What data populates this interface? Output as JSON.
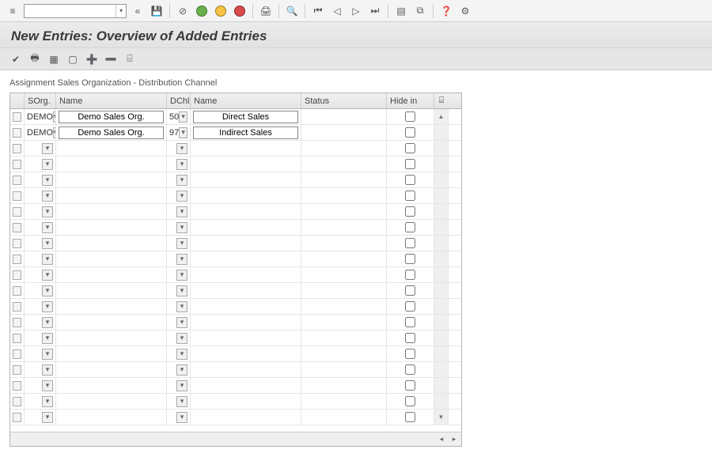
{
  "title": "New Entries: Overview of Added Entries",
  "section_label": "Assignment Sales Organization - Distribution Channel",
  "columns": {
    "sorg": "SOrg.",
    "name1": "Name",
    "dchl": "DChl",
    "name2": "Name",
    "status": "Status",
    "hide": "Hide in"
  },
  "rows": [
    {
      "sorg": "DEMO",
      "name1": "Demo Sales Org.",
      "dchl": "50",
      "name2": "Direct Sales",
      "status": "",
      "hide": false
    },
    {
      "sorg": "DEMO",
      "name1": "Demo Sales Org.",
      "dchl": "97",
      "name2": "Indirect Sales",
      "status": "",
      "hide": false
    }
  ],
  "empty_row_count": 18,
  "icons": {
    "menu": "≡",
    "back": "«",
    "save": "💾",
    "cancel": "⊘",
    "print": "🖨",
    "find": "🔍",
    "first": "⏮",
    "prev": "◁",
    "next": "▷",
    "last": "⏭",
    "new_entries": "▤",
    "copy_entries": "⧉",
    "help": "❓",
    "layout": "⚙",
    "check": "✔",
    "printapp": "🖶",
    "select_all": "▦",
    "deselect": "▢",
    "insert_row": "➕",
    "delete_row": "➖",
    "config": "⌸"
  }
}
